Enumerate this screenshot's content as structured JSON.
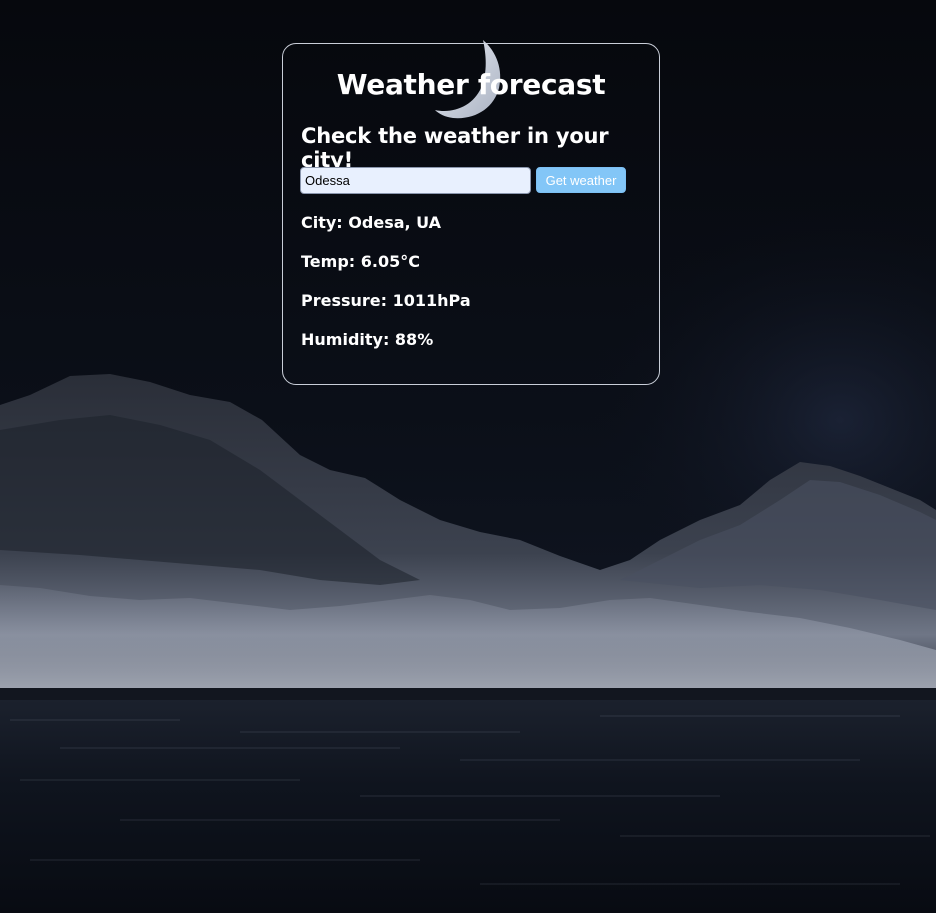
{
  "card": {
    "title": "Weather forecast",
    "subtitle": "Check the weather in your city!"
  },
  "search": {
    "value": "Odessa",
    "button_label": "Get weather"
  },
  "result": {
    "city_label": "City: ",
    "city": "Odesa, UA",
    "temp_label": "Temp: ",
    "temp": "6.05°C",
    "pressure_label": "Pressure: ",
    "pressure": "1011hPa",
    "humidity_label": "Humidity: ",
    "humidity": "88%"
  },
  "colors": {
    "background": "#05070c",
    "card_border": "#c9ced8",
    "input_bg": "#e8f0fe",
    "button_bg": "#83c6f7",
    "text": "#ffffff"
  },
  "icons": {
    "moon": "crescent-moon-icon"
  }
}
